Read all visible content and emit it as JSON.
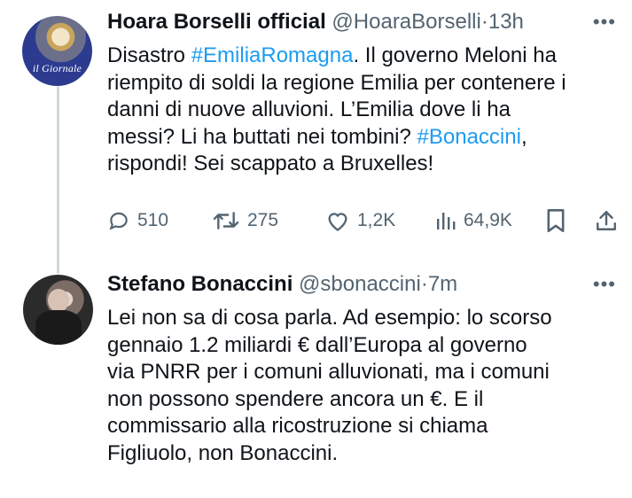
{
  "tweet1": {
    "avatar_text": "il Giornale",
    "name": "Hoara Borselli official",
    "handle": "@HoaraBorselli",
    "separator": "·",
    "time": "13h",
    "lines": [
      {
        "pre": "Disastro ",
        "tag": "#EmiliaRomagna",
        "post": ". Il governo Meloni ha"
      },
      {
        "pre": "riempito di soldi la regione Emilia per contenere i",
        "tag": "",
        "post": ""
      },
      {
        "pre": "danni di  nuove alluvioni. L’Emilia dove li ha",
        "tag": "",
        "post": ""
      },
      {
        "pre": "messi? Li ha buttati nei tombini? ",
        "tag": "#Bonaccini",
        "post": ","
      },
      {
        "pre": "rispondi! Sei scappato a Bruxelles!",
        "tag": "",
        "post": ""
      }
    ],
    "actions": {
      "replies": "510",
      "retweets": "275",
      "likes": "1,2K",
      "views": "64,9K"
    }
  },
  "tweet2": {
    "name": "Stefano Bonaccini",
    "handle": "@sbonaccini",
    "separator": "·",
    "time": "7m",
    "lines": [
      "Lei non sa di cosa parla. Ad esempio: lo scorso",
      "gennaio 1.2 miliardi € dall’Europa al governo",
      "via PNRR per i comuni alluvionati, ma i comuni",
      "non possono spendere ancora un €. E il",
      "commissario alla ricostruzione si chiama",
      "Figliuolo, non Bonaccini."
    ]
  },
  "more_glyph": "•••",
  "colors": {
    "text": "#0f1419",
    "secondary": "#536471",
    "hashtag": "#1d9bf0",
    "thread_line": "#cfd9de"
  }
}
